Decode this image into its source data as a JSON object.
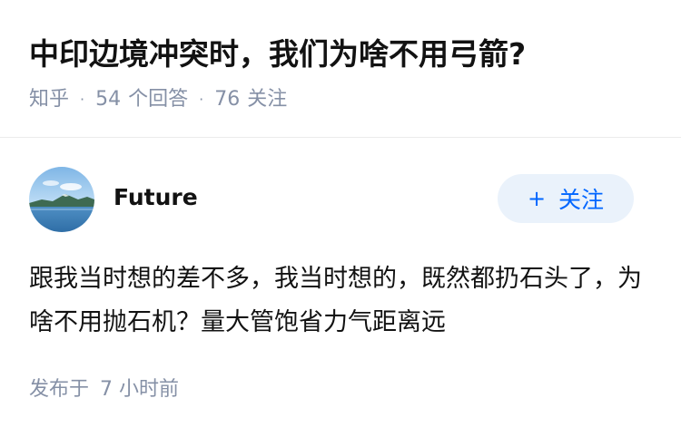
{
  "question": {
    "title": "中印边境冲突时，我们为啥不用弓箭?",
    "source": "知乎",
    "answer_count": "54",
    "answer_label": "个回答",
    "follow_count": "76",
    "follow_label": "关注"
  },
  "answer": {
    "author_name": "Future",
    "follow_button_label": "关注",
    "follow_button_icon": "plus-icon",
    "content": "跟我当时想的差不多，我当时想的，既然都扔石头了，为啥不用抛石机？量大管饱省力气距离远",
    "posted_label": "发布于",
    "posted_time": "7 小时前"
  },
  "colors": {
    "accent": "#0066ff",
    "follow_bg": "#eaf2fb",
    "meta_gray": "#8590a6",
    "text": "#121212"
  }
}
